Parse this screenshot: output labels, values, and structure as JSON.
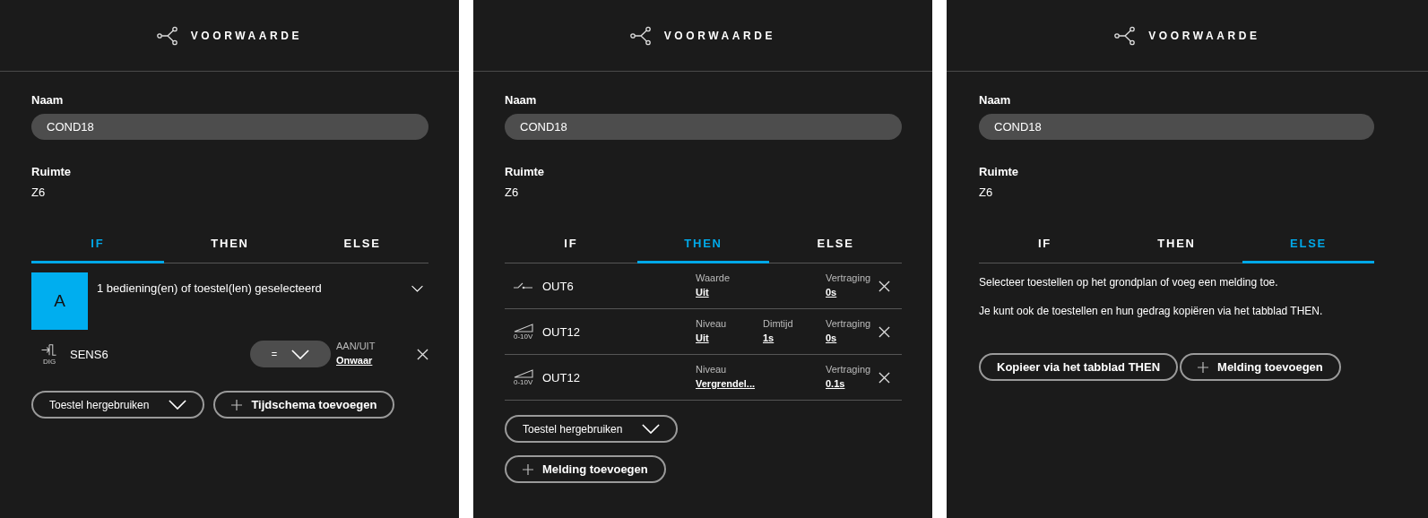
{
  "panels": [
    {
      "title": "VOORWAARDE",
      "fields": [
        {
          "kind": "input",
          "label": "Naam",
          "value": "COND18"
        },
        {
          "kind": "text",
          "label": "Ruimte",
          "value": "Z6"
        }
      ],
      "tabs": [
        {
          "label": "IF",
          "selected": true
        },
        {
          "label": "THEN",
          "selected": false
        },
        {
          "label": "ELSE",
          "selected": false
        }
      ],
      "content": {
        "kind": "condition",
        "badge": "A",
        "summary": "1 bediening(en) of toestel(len) geselecteerd",
        "device": {
          "name": "SENS6",
          "icon_text": "DIG",
          "operator": "=",
          "attribute": "AAN/UIT",
          "value": "Onwaar"
        }
      },
      "buttons": [
        {
          "kind": "dropdown",
          "label": "Toestel hergebruiken"
        },
        {
          "kind": "add",
          "label": "Tijdschema toevoegen"
        }
      ]
    },
    {
      "title": "VOORWAARDE",
      "fields": [
        {
          "kind": "input",
          "label": "Naam",
          "value": "COND18"
        },
        {
          "kind": "text",
          "label": "Ruimte",
          "value": "Z6"
        }
      ],
      "tabs": [
        {
          "label": "IF",
          "selected": false
        },
        {
          "label": "THEN",
          "selected": true
        },
        {
          "label": "ELSE",
          "selected": false
        }
      ],
      "content": {
        "kind": "actions",
        "rows": [
          {
            "kind": "switch",
            "name": "OUT6",
            "params": [
              {
                "label": "Waarde",
                "value": "Uit"
              }
            ],
            "delay": {
              "label": "Vertraging",
              "value": "0s"
            }
          },
          {
            "kind": "dimmer",
            "icon_text": "0-10V",
            "name": "OUT12",
            "params": [
              {
                "label": "Niveau",
                "value": "Uit"
              },
              {
                "label": "Dimtijd",
                "value": "1s"
              }
            ],
            "delay": {
              "label": "Vertraging",
              "value": "0s"
            }
          },
          {
            "kind": "dimmer",
            "icon_text": "0-10V",
            "name": "OUT12",
            "params": [
              {
                "label": "Niveau",
                "value": "Vergrendel..."
              }
            ],
            "delay": {
              "label": "Vertraging",
              "value": "0.1s"
            }
          }
        ]
      },
      "buttons": [
        {
          "kind": "dropdown",
          "label": "Toestel hergebruiken"
        },
        {
          "kind": "add",
          "label": "Melding toevoegen"
        }
      ]
    },
    {
      "title": "VOORWAARDE",
      "fields": [
        {
          "kind": "input",
          "label": "Naam",
          "value": "COND18"
        },
        {
          "kind": "text",
          "label": "Ruimte",
          "value": "Z6"
        }
      ],
      "tabs": [
        {
          "label": "IF",
          "selected": false
        },
        {
          "label": "THEN",
          "selected": false
        },
        {
          "label": "ELSE",
          "selected": true
        }
      ],
      "content": {
        "kind": "message",
        "paragraphs": [
          "Selecteer toestellen op het grondplan of voeg een melding toe.",
          "Je kunt ook de toestellen en hun gedrag kopiëren via het tabblad THEN."
        ]
      },
      "buttons": [
        {
          "kind": "plain",
          "label": "Kopieer via het tabblad THEN"
        },
        {
          "kind": "add",
          "label": "Melding toevoegen"
        }
      ]
    }
  ]
}
